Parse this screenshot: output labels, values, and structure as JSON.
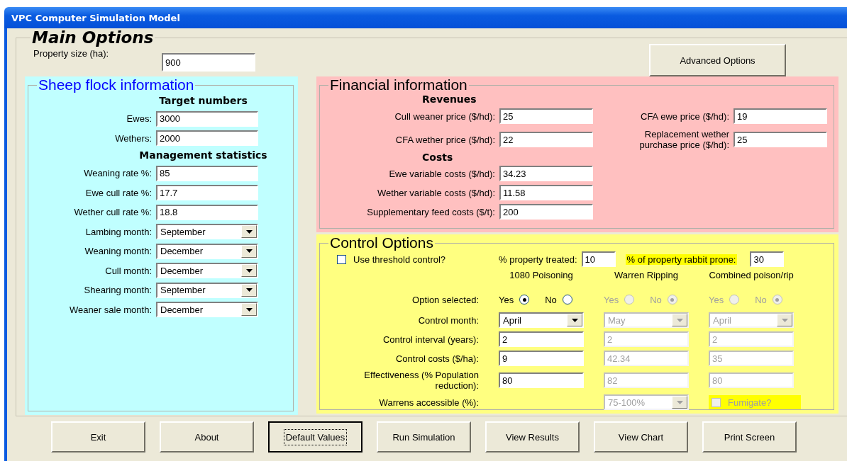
{
  "window": {
    "title": "VPC Computer Simulation Model"
  },
  "main": {
    "title": "Main Options",
    "property": {
      "label": "Property size (ha):",
      "value": "900"
    },
    "advanced_button": "Advanced Options"
  },
  "sheep": {
    "title": "Sheep flock information",
    "sections": [
      {
        "heading": "Target numbers",
        "fields": [
          {
            "label": "Ewes:",
            "value": "3000",
            "kind": "text"
          },
          {
            "label": "Wethers:",
            "value": "2000",
            "kind": "text"
          }
        ]
      },
      {
        "heading": "Management statistics",
        "fields": [
          {
            "label": "Weaning rate %:",
            "value": "85",
            "kind": "text"
          },
          {
            "label": "Ewe cull rate %:",
            "value": "17.7",
            "kind": "text"
          },
          {
            "label": "Wether cull rate %:",
            "value": "18.8",
            "kind": "text"
          },
          {
            "label": "Lambing month:",
            "value": "September",
            "kind": "dropdown"
          },
          {
            "label": "Weaning month:",
            "value": "December",
            "kind": "dropdown"
          },
          {
            "label": "Cull month:",
            "value": "December",
            "kind": "dropdown"
          },
          {
            "label": "Shearing month:",
            "value": "September",
            "kind": "dropdown"
          },
          {
            "label": "Weaner sale month:",
            "value": "December",
            "kind": "dropdown"
          }
        ]
      }
    ]
  },
  "financial": {
    "title": "Financial information",
    "revenues_heading": "Revenues",
    "revenues": [
      {
        "label": "Cull weaner price ($/hd):",
        "value": "25"
      },
      {
        "label": "CFA wether price ($/hd):",
        "value": "22"
      },
      {
        "label": "CFA ewe price ($/hd):",
        "value": "19"
      },
      {
        "label": "Replacement wether purchase price ($/hd):",
        "value": "25"
      }
    ],
    "costs_heading": "Costs",
    "costs": [
      {
        "label": "Ewe variable costs ($/hd):",
        "value": "34.23"
      },
      {
        "label": "Wether variable costs ($/hd):",
        "value": "11.58"
      },
      {
        "label": "Supplementary feed costs ($/t):",
        "value": "200"
      }
    ]
  },
  "control": {
    "title": "Control Options",
    "threshold": {
      "label": "Use threshold control?",
      "checked": false
    },
    "treated": {
      "label": "% property treated:",
      "value": "10"
    },
    "rabbit_prone": {
      "label": "% of property rabbit prone:",
      "value": "30"
    },
    "row_labels": [
      "Option selected:",
      "Control month:",
      "Control interval (years):",
      "Control costs ($/ha):",
      "Effectiveness (% Population reduction):",
      "Warrens accessible (%):"
    ],
    "methods": [
      {
        "name": "1080 Poisoning",
        "disabled": false,
        "options": [
          {
            "label": "Yes",
            "selected": true
          },
          {
            "label": "No",
            "selected": false
          }
        ],
        "month": "April",
        "interval": "2",
        "costs": "9",
        "effectiveness": "80",
        "extra": {
          "kind": "none"
        }
      },
      {
        "name": "Warren Ripping",
        "disabled": true,
        "options": [
          {
            "label": "Yes",
            "selected": false
          },
          {
            "label": "No",
            "selected": true
          }
        ],
        "month": "May",
        "interval": "2",
        "costs": "42.34",
        "effectiveness": "82",
        "extra": {
          "kind": "dropdown",
          "value": "75-100%"
        }
      },
      {
        "name": "Combined poison/rip",
        "disabled": true,
        "options": [
          {
            "label": "Yes",
            "selected": false
          },
          {
            "label": "No",
            "selected": true
          }
        ],
        "month": "April",
        "interval": "2",
        "costs": "35",
        "effectiveness": "80",
        "extra": {
          "kind": "checkbox",
          "label": "Fumigate?",
          "checked": false
        }
      }
    ]
  },
  "buttons": [
    {
      "label": "Exit",
      "focused": false
    },
    {
      "label": "About",
      "focused": false
    },
    {
      "label": "Default Values",
      "focused": true
    },
    {
      "label": "Run Simulation",
      "focused": false
    },
    {
      "label": "View Results",
      "focused": false
    },
    {
      "label": "View Chart",
      "focused": false
    },
    {
      "label": "Print Screen",
      "focused": false
    }
  ]
}
